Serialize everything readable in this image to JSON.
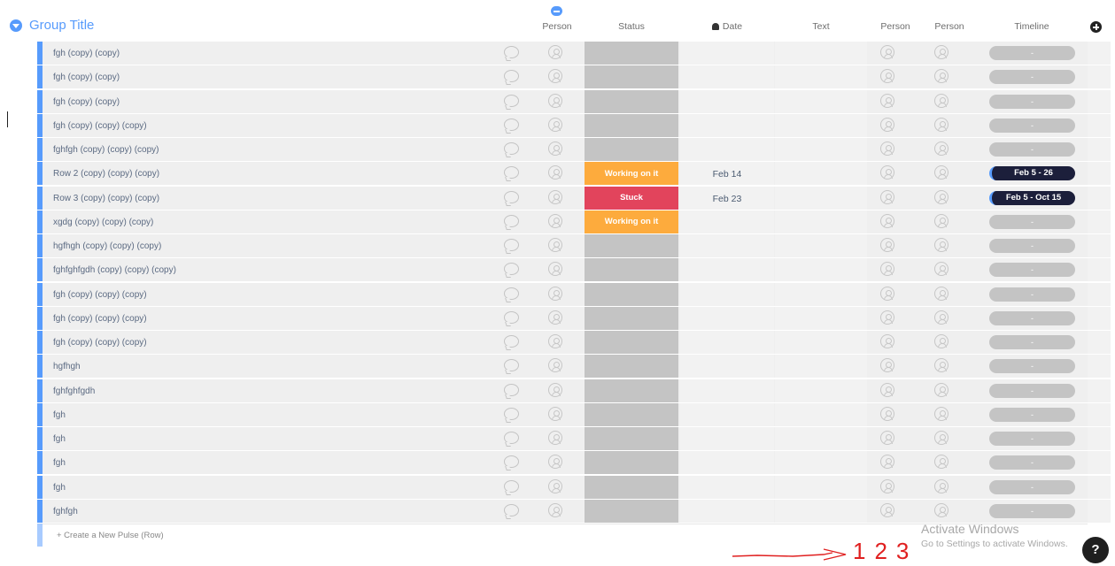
{
  "group": {
    "title": "Group Title",
    "color": "#579bfc"
  },
  "columns": {
    "person": "Person",
    "status": "Status",
    "date": "Date",
    "text": "Text",
    "person2": "Person",
    "person3": "Person",
    "timeline": "Timeline"
  },
  "status_colors": {
    "Working on it": "#fdab3d",
    "Stuck": "#e2445c"
  },
  "rows": [
    {
      "name": "fgh (copy) (copy)",
      "status": "",
      "date": "",
      "timeline": "-"
    },
    {
      "name": "fgh (copy) (copy)",
      "status": "",
      "date": "",
      "timeline": "-"
    },
    {
      "name": "fgh (copy) (copy)",
      "status": "",
      "date": "",
      "timeline": "-"
    },
    {
      "name": "fgh (copy) (copy) (copy)",
      "status": "",
      "date": "",
      "timeline": "-"
    },
    {
      "name": "fghfgh (copy) (copy) (copy)",
      "status": "",
      "date": "",
      "timeline": "-"
    },
    {
      "name": "Row 2 (copy) (copy) (copy)",
      "status": "Working on it",
      "date": "Feb 14",
      "timeline": "Feb 5 - 26"
    },
    {
      "name": "Row 3 (copy) (copy) (copy)",
      "status": "Stuck",
      "date": "Feb 23",
      "timeline": "Feb 5 - Oct 15"
    },
    {
      "name": "xgdg (copy) (copy) (copy)",
      "status": "Working on it",
      "date": "",
      "timeline": "-"
    },
    {
      "name": "hgfhgh (copy) (copy) (copy)",
      "status": "",
      "date": "",
      "timeline": "-"
    },
    {
      "name": "fghfghfgdh (copy) (copy) (copy)",
      "status": "",
      "date": "",
      "timeline": "-"
    },
    {
      "name": "fgh (copy) (copy) (copy)",
      "status": "",
      "date": "",
      "timeline": "-"
    },
    {
      "name": "fgh (copy) (copy) (copy)",
      "status": "",
      "date": "",
      "timeline": "-"
    },
    {
      "name": "fgh (copy) (copy) (copy)",
      "status": "",
      "date": "",
      "timeline": "-"
    },
    {
      "name": "hgfhgh",
      "status": "",
      "date": "",
      "timeline": "-"
    },
    {
      "name": "fghfghfgdh",
      "status": "",
      "date": "",
      "timeline": "-"
    },
    {
      "name": "fgh",
      "status": "",
      "date": "",
      "timeline": "-"
    },
    {
      "name": "fgh",
      "status": "",
      "date": "",
      "timeline": "-"
    },
    {
      "name": "fgh",
      "status": "",
      "date": "",
      "timeline": "-"
    },
    {
      "name": "fgh",
      "status": "",
      "date": "",
      "timeline": "-"
    },
    {
      "name": "fghfgh",
      "status": "",
      "date": "",
      "timeline": "-"
    }
  ],
  "new_row": {
    "label": "+ Create a New Pulse (Row)"
  },
  "watermark": {
    "line1": "Activate Windows",
    "line2": "Go to Settings to activate Windows."
  },
  "help": {
    "label": "?"
  },
  "annotation": {
    "text": "1 2 3",
    "color": "#e02020"
  }
}
